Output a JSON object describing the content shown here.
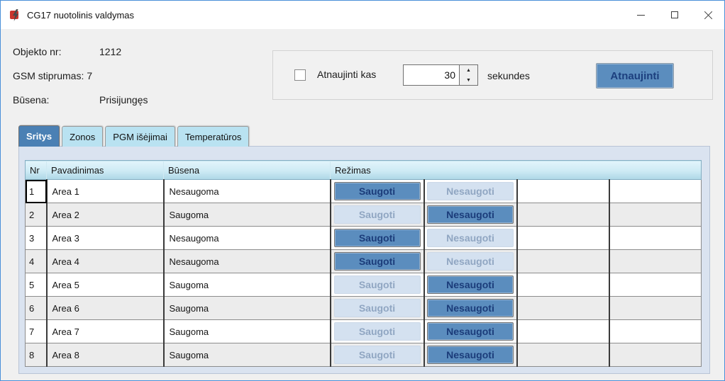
{
  "window": {
    "title": "CG17 nuotolinis valdymas",
    "icons": {
      "app": "lightning-bolt-icon",
      "minimize": "minimize-icon",
      "maximize": "maximize-icon",
      "close": "close-icon"
    }
  },
  "info": {
    "rows": [
      {
        "label": "Objekto nr:",
        "value": "1212"
      },
      {
        "label": "GSM stiprumas:",
        "value": "7"
      },
      {
        "label": "Būsena:",
        "value": "Prisijungęs"
      }
    ]
  },
  "refresh": {
    "checkbox_checked": false,
    "checkbox_label": "Atnaujinti kas",
    "interval_value": "30",
    "unit_label": "sekundes",
    "button_label": "Atnaujinti",
    "spin_up_icon": "▲",
    "spin_down_icon": "▼"
  },
  "tabs": [
    {
      "label": "Sritys",
      "active": true
    },
    {
      "label": "Zonos",
      "active": false
    },
    {
      "label": "PGM išėjimai",
      "active": false
    },
    {
      "label": "Temperatūros",
      "active": false
    }
  ],
  "table": {
    "headers": [
      "Nr",
      "Pavadinimas",
      "Būsena",
      "Režimas"
    ],
    "arm_label": "Saugoti",
    "disarm_label": "Nesaugoti",
    "rows": [
      {
        "nr": "1",
        "name": "Area 1",
        "state": "Nesaugoma",
        "armed": false
      },
      {
        "nr": "2",
        "name": "Area 2",
        "state": "Saugoma",
        "armed": true
      },
      {
        "nr": "3",
        "name": "Area 3",
        "state": "Nesaugoma",
        "armed": false
      },
      {
        "nr": "4",
        "name": "Area 4",
        "state": "Nesaugoma",
        "armed": false
      },
      {
        "nr": "5",
        "name": "Area 5",
        "state": "Saugoma",
        "armed": true
      },
      {
        "nr": "6",
        "name": "Area 6",
        "state": "Saugoma",
        "armed": true
      },
      {
        "nr": "7",
        "name": "Area 7",
        "state": "Saugoma",
        "armed": true
      },
      {
        "nr": "8",
        "name": "Area 8",
        "state": "Saugoma",
        "armed": true
      }
    ]
  },
  "colors": {
    "window_border": "#4a90d9",
    "accent_steel_blue": "#5b8dbe",
    "active_tab_blue": "#4a80b4",
    "inactive_tab_blue": "#b9e2f1",
    "panel_background": "#dae3f0",
    "header_gradient_top": "#e2f4fb",
    "header_gradient_bottom": "#aed7e6",
    "row_alt": "#ececec",
    "dark_button_text": "#1b3c7a",
    "light_button_text": "#90a6c2"
  }
}
